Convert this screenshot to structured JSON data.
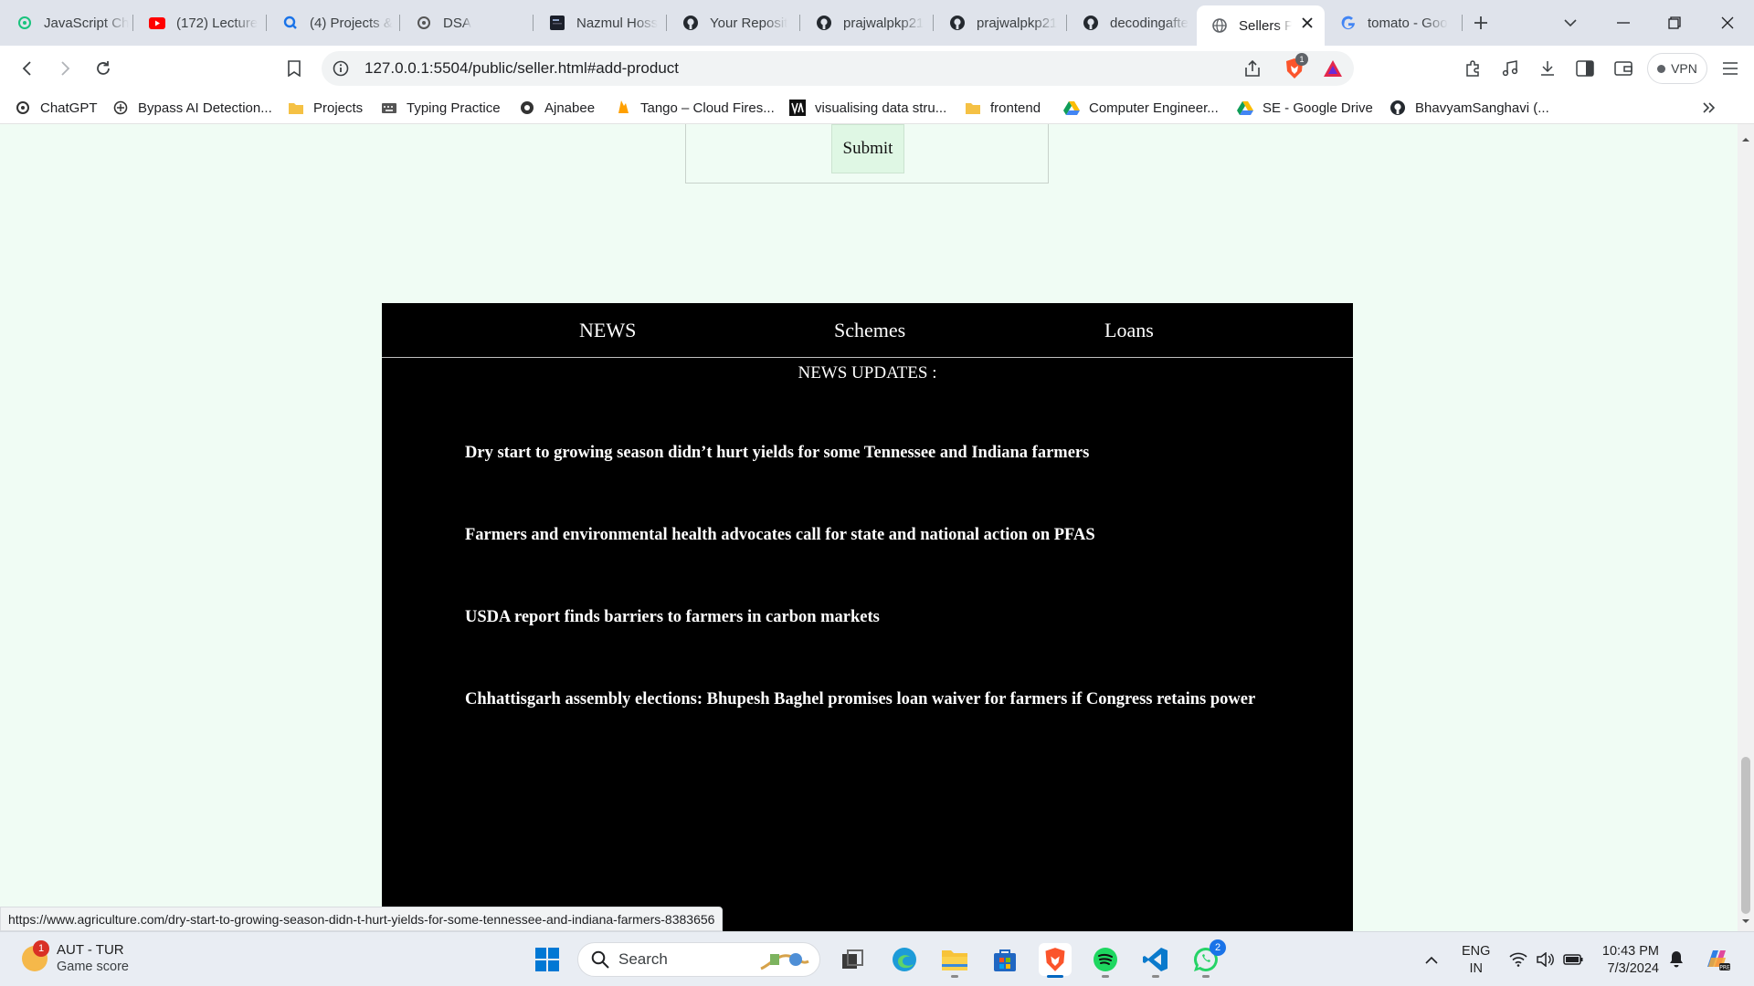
{
  "browser": {
    "tabs": [
      {
        "label": "JavaScript Ch",
        "icon": "chatgpt-icon"
      },
      {
        "label": "(172) Lecture",
        "icon": "youtube-icon"
      },
      {
        "label": "(4) Projects &",
        "icon": "app-icon"
      },
      {
        "label": "DSA",
        "icon": "chatgpt-icon"
      },
      {
        "label": "Nazmul Hoss",
        "icon": "website-icon"
      },
      {
        "label": "Your Reposit",
        "icon": "github-icon"
      },
      {
        "label": "prajwalpkp21",
        "icon": "github-icon"
      },
      {
        "label": "prajwalpkp21",
        "icon": "github-icon"
      },
      {
        "label": "decodingafte",
        "icon": "github-icon"
      },
      {
        "label": "Sellers P",
        "icon": "globe-icon",
        "active": true
      },
      {
        "label": "tomato - Goo",
        "icon": "google-icon"
      }
    ],
    "address": "127.0.0.1:5504/public/seller.html#add-product",
    "vpn_label": "VPN",
    "shield_count": "1",
    "bookmarks": [
      {
        "label": "ChatGPT",
        "icon": "chatgpt-icon"
      },
      {
        "label": "Bypass AI Detection...",
        "icon": "ai-icon"
      },
      {
        "label": "Projects",
        "icon": "folder-icon"
      },
      {
        "label": "Typing Practice",
        "icon": "typing-icon"
      },
      {
        "label": "Ajnabee",
        "icon": "chat-icon"
      },
      {
        "label": "Tango – Cloud Fires...",
        "icon": "flame-icon"
      },
      {
        "label": "visualising data stru...",
        "icon": "va-icon"
      },
      {
        "label": "frontend",
        "icon": "folder-icon"
      },
      {
        "label": "Computer Engineer...",
        "icon": "drive-icon"
      },
      {
        "label": "SE - Google Drive",
        "icon": "drive-icon"
      },
      {
        "label": "BhavyamSanghavi (...",
        "icon": "github-icon"
      }
    ]
  },
  "page": {
    "submit_label": "Submit",
    "nav": [
      "NEWS",
      "Schemes",
      "Loans"
    ],
    "news_title": "NEWS UPDATES :",
    "headlines": [
      "Dry start to growing season didn’t hurt yields for some Tennessee and Indiana farmers",
      "Farmers and environmental health advocates call for state and national action on PFAS",
      "USDA report finds barriers to farmers in carbon markets",
      "Chhattisgarh assembly elections: Bhupesh Baghel promises loan waiver for farmers if Congress retains power"
    ],
    "status_url": "https://www.agriculture.com/dry-start-to-growing-season-didn-t-hurt-yields-for-some-tennessee-and-indiana-farmers-8383656"
  },
  "taskbar": {
    "weather_title": "AUT - TUR",
    "weather_sub": "Game score",
    "weather_badge": "1",
    "search_placeholder": "Search",
    "whatsapp_badge": "2",
    "lang_line1": "ENG",
    "lang_line2": "IN",
    "time": "10:43 PM",
    "date": "7/3/2024"
  },
  "colors": {
    "page_bg": "#f0fcf4",
    "news_bg": "#000000",
    "submit_bg": "#dff7e4",
    "tabstrip_bg": "#dfe3eb"
  }
}
